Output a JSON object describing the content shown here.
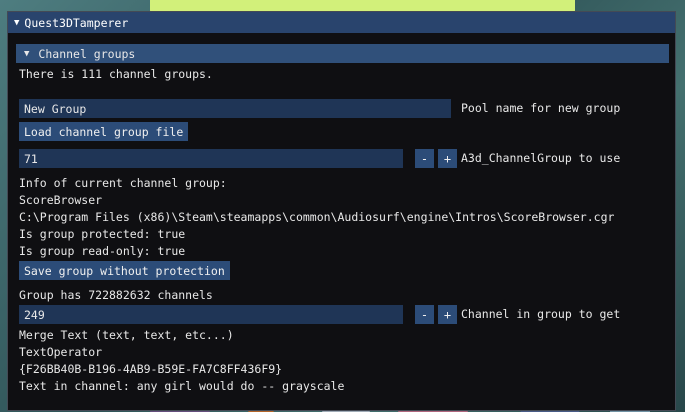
{
  "window": {
    "title": "Quest3DTamperer"
  },
  "section": {
    "title": "Channel groups"
  },
  "summary": "There is 111 channel groups.",
  "new_pool": {
    "value": "New Group",
    "label": "Pool name for new group"
  },
  "load_button": "Load channel group file",
  "group_select": {
    "value": "71",
    "minus": "-",
    "plus": "+",
    "label": "A3d_ChannelGroup to use"
  },
  "info": {
    "heading": "Info of current channel group:",
    "name": "ScoreBrowser",
    "path": "C:\\Program Files (x86)\\Steam\\steamapps\\common\\Audiosurf\\engine\\Intros\\ScoreBrowser.cgr",
    "protected": "Is group protected: true",
    "readonly": "Is group read-only: true"
  },
  "save_button": "Save group without protection",
  "channel_count": "Group has 722882632 channels",
  "channel_select": {
    "value": "249",
    "minus": "-",
    "plus": "+",
    "label": "Channel in group to get"
  },
  "channel": {
    "type": "Merge Text (text, text, etc...)",
    "name": "TextOperator",
    "guid": "{F26BB40B-B196-4AB9-B59E-FA7C8FF436F9}",
    "text": "Text in channel: any girl would do -- grayscale"
  },
  "icons": {
    "collapse": "triangle-down-icon"
  },
  "colors": {
    "titlebar": "#29446d",
    "header": "#30507a",
    "button": "#2c4c78",
    "field": "#1f3556",
    "bg": "#0f0f12"
  }
}
